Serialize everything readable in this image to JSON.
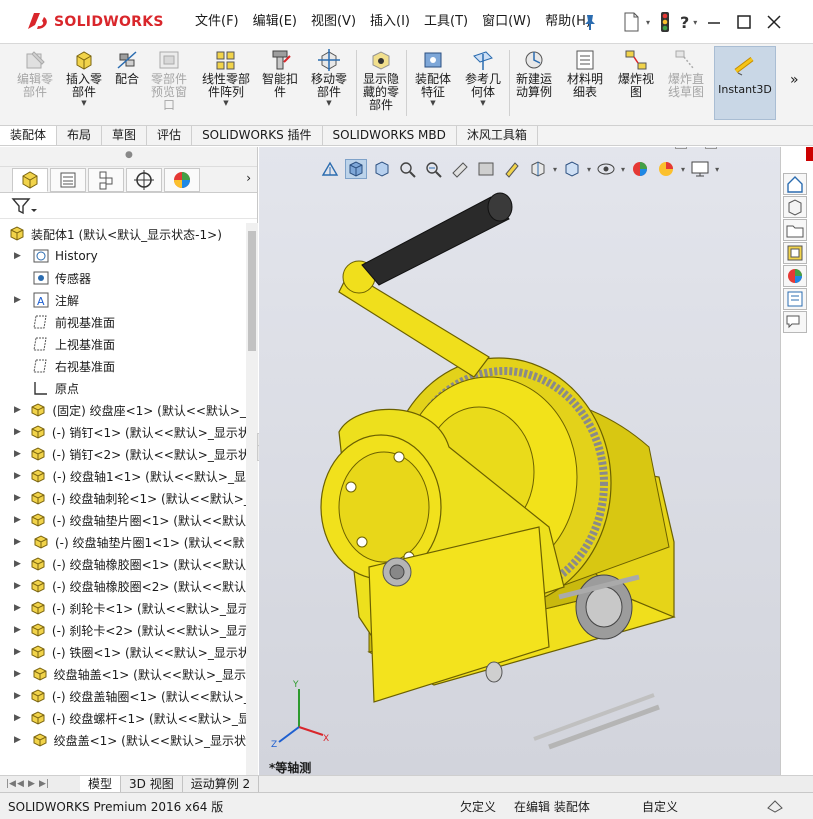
{
  "app": {
    "brand": "SOLIDWORKS"
  },
  "menu": [
    "文件(F)",
    "编辑(E)",
    "视图(V)",
    "插入(I)",
    "工具(T)",
    "窗口(W)",
    "帮助(H)"
  ],
  "commands": [
    {
      "label": "编辑零\n部件",
      "icon": "edit-component-icon",
      "disabled": true
    },
    {
      "label": "插入零\n部件",
      "icon": "insert-component-icon",
      "disabled": false,
      "dropdown": true
    },
    {
      "label": "配合",
      "icon": "mate-icon",
      "disabled": false
    },
    {
      "label": "零部件\n预览窗\n口",
      "icon": "component-preview-icon",
      "disabled": true
    },
    {
      "label": "线性零部\n件阵列",
      "icon": "linear-pattern-icon",
      "disabled": false,
      "dropdown": true
    },
    {
      "label": "智能扣\n件",
      "icon": "smart-fastener-icon",
      "disabled": false
    },
    {
      "label": "移动零\n部件",
      "icon": "move-component-icon",
      "disabled": false,
      "dropdown": true
    },
    {
      "label": "显示隐\n藏的零\n部件",
      "icon": "show-hidden-icon",
      "disabled": false
    },
    {
      "label": "装配体\n特征",
      "icon": "assembly-feature-icon",
      "disabled": false,
      "dropdown": true
    },
    {
      "label": "参考几\n何体",
      "icon": "reference-geometry-icon",
      "disabled": false,
      "dropdown": true
    },
    {
      "label": "新建运\n动算例",
      "icon": "new-motion-study-icon",
      "disabled": false
    },
    {
      "label": "材料明\n细表",
      "icon": "bom-icon",
      "disabled": false
    },
    {
      "label": "爆炸视\n图",
      "icon": "exploded-view-icon",
      "disabled": false
    },
    {
      "label": "爆炸直\n线草图",
      "icon": "explode-line-sketch-icon",
      "disabled": true
    },
    {
      "label": "Instant3D",
      "icon": "instant3d-icon",
      "disabled": false,
      "active": true
    }
  ],
  "command_tabs": [
    "装配体",
    "布局",
    "草图",
    "评估",
    "SOLIDWORKS 插件",
    "SOLIDWORKS MBD",
    "沐风工具箱"
  ],
  "tree": {
    "root": "装配体1 (默认<默认_显示状态-1>)",
    "items": [
      {
        "label": "History",
        "icon": "history-icon",
        "expandable": true
      },
      {
        "label": "传感器",
        "icon": "sensor-icon",
        "expandable": false
      },
      {
        "label": "注解",
        "icon": "annotation-icon",
        "expandable": true
      },
      {
        "label": "前视基准面",
        "icon": "plane-icon",
        "expandable": false
      },
      {
        "label": "上视基准面",
        "icon": "plane-icon",
        "expandable": false
      },
      {
        "label": "右视基准面",
        "icon": "plane-icon",
        "expandable": false
      },
      {
        "label": "原点",
        "icon": "origin-icon",
        "expandable": false
      },
      {
        "label": "(固定) 绞盘座<1> (默认<<默认>_",
        "icon": "part-icon",
        "expandable": true
      },
      {
        "label": "(-) 销钉<1> (默认<<默认>_显示状",
        "icon": "part-icon",
        "expandable": true
      },
      {
        "label": "(-) 销钉<2> (默认<<默认>_显示状",
        "icon": "part-icon",
        "expandable": true
      },
      {
        "label": "(-) 绞盘轴1<1> (默认<<默认>_显",
        "icon": "part-icon",
        "expandable": true
      },
      {
        "label": "(-) 绞盘轴刺轮<1> (默认<<默认>_",
        "icon": "part-icon",
        "expandable": true
      },
      {
        "label": "(-) 绞盘轴垫片圈<1> (默认<<默认",
        "icon": "part-icon",
        "expandable": true
      },
      {
        "label": "(-) 绞盘轴垫片圈1<1> (默认<<默",
        "icon": "part-icon",
        "expandable": true
      },
      {
        "label": "(-) 绞盘轴橡胶圈<1> (默认<<默认",
        "icon": "part-icon",
        "expandable": true
      },
      {
        "label": "(-) 绞盘轴橡胶圈<2> (默认<<默认",
        "icon": "part-icon",
        "expandable": true
      },
      {
        "label": "(-) 刹轮卡<1> (默认<<默认>_显示",
        "icon": "part-icon",
        "expandable": true
      },
      {
        "label": "(-) 刹轮卡<2> (默认<<默认>_显示",
        "icon": "part-icon",
        "expandable": true
      },
      {
        "label": "(-) 铁圈<1> (默认<<默认>_显示状",
        "icon": "part-icon",
        "expandable": true
      },
      {
        "label": "绞盘轴盖<1> (默认<<默认>_显示",
        "icon": "part-icon",
        "expandable": true
      },
      {
        "label": "(-) 绞盘盖轴圈<1> (默认<<默认>_",
        "icon": "part-icon",
        "expandable": true
      },
      {
        "label": "(-) 绞盘螺杆<1> (默认<<默认>_显",
        "icon": "part-icon",
        "expandable": true
      },
      {
        "label": "绞盘盖<1> (默认<<默认>_显示状",
        "icon": "part-icon",
        "expandable": true
      }
    ]
  },
  "viewport": {
    "view_name": "*等轴测"
  },
  "model_tabs": [
    "模型",
    "3D 视图",
    "运动算例 2"
  ],
  "status": {
    "product": "SOLIDWORKS Premium 2016 x64 版",
    "defined": "欠定义",
    "editing": "在编辑 装配体",
    "units": "自定义"
  },
  "colors": {
    "brand": "#d9262b",
    "part_yellow": "#f2e21a",
    "viewport_bg": "#dcdee5",
    "instant3d_bg": "#c9d7e6"
  }
}
